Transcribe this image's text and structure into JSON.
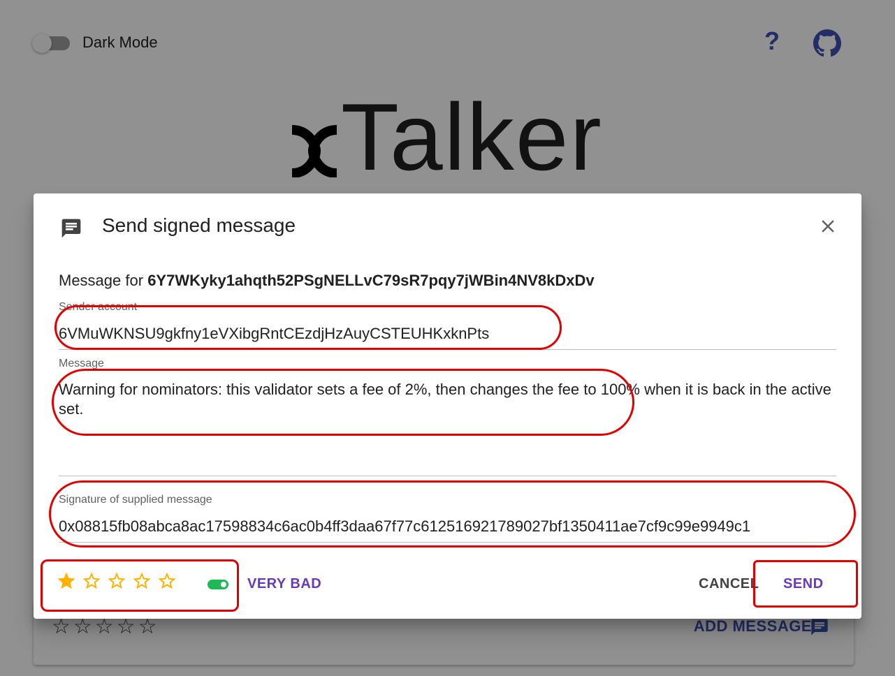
{
  "header": {
    "dark_mode_label": "Dark Mode",
    "dark_mode_on": false,
    "help_icon_glyph": "?",
    "icons": [
      "help-icon",
      "github-icon"
    ]
  },
  "logo": {
    "text": "Talker",
    "brand_mark": "polkadot-x-mark"
  },
  "background": {
    "rating_stars": "☆☆☆☆☆",
    "add_message_label": "ADD MESSAGE"
  },
  "dialog": {
    "title": "Send signed message",
    "icon": "chat-icon",
    "close_icon": "close-icon",
    "message_for_prefix": "Message for",
    "message_for_address": "6Y7WKyky1ahqth52PSgNELLvC79sR7pqy7jWBin4NV8kDxDv",
    "sender": {
      "label": "Sender account",
      "value": "6VMuWKNSU9gkfny1eVXibgRntCEzdjHzAuyCSTEUHKxknPts"
    },
    "message": {
      "label": "Message",
      "value": "Warning for nominators: this validator sets a fee of 2%, then changes the fee to 100% when it is back in the active set."
    },
    "signature": {
      "label": "Signature of supplied message",
      "value": "0x08815fb08abca8ac17598834c6ac0b4ff3daa67f77c612516921789027bf1350411ae7cf9c99e9949c1"
    },
    "rating": {
      "value": 1,
      "max": 5,
      "toggle_on": true,
      "label": "VERY BAD"
    },
    "cancel_label": "CANCEL",
    "send_label": "SEND"
  },
  "colors": {
    "accent": "#673ab7",
    "icon_blue": "#3f51b5",
    "star": "#ffb300",
    "toggle": "#1db954",
    "annotation": "#e00000"
  }
}
